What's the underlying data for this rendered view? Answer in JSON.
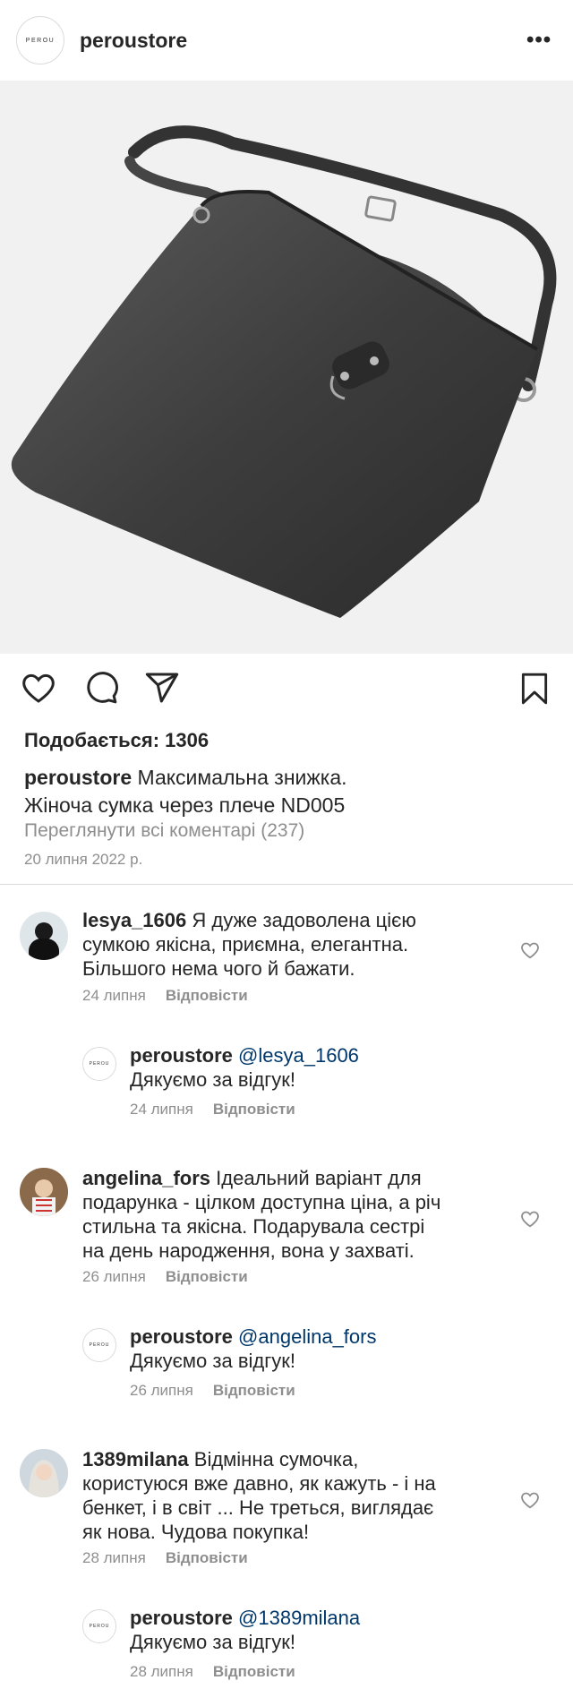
{
  "header": {
    "logo_text": "PEROU",
    "username": "peroustore",
    "more": "•••"
  },
  "post": {
    "likes": "Подобається: 1306",
    "caption_user": "peroustore",
    "caption_line1": "Максимальна знижка.",
    "caption_line2": "Жіноча сумка через плече ND005",
    "view_all": "Переглянути всі коментарі (237)",
    "date": "20 липня 2022 р."
  },
  "comments": [
    {
      "user": "lesya_1606",
      "lines": [
        "Я дуже задоволена цією",
        "сумкою якісна, приємна, елегантна.",
        "Більшого нема чого й бажати."
      ],
      "date": "24 липня",
      "reply": "Відповісти",
      "answer": {
        "user": "peroustore",
        "mention": "@lesya_1606",
        "text": "Дякуємо за відгук!",
        "date": "24 липня",
        "reply": "Відповісти"
      }
    },
    {
      "user": "angelina_fors",
      "lines": [
        "Ідеальний варіант для",
        "подарунка - цілком доступна ціна, а річ",
        "стильна та якісна. Подарувала сестрі",
        "на день народження, вона у захваті."
      ],
      "date": "26 липня",
      "reply": "Відповісти",
      "answer": {
        "user": "peroustore",
        "mention": "@angelina_fors",
        "text": "Дякуємо за відгук!",
        "date": "26 липня",
        "reply": "Відповісти"
      }
    },
    {
      "user": "1389milana",
      "lines": [
        "Відмінна сумочка,",
        "користуюся вже давно, як кажуть - і на",
        "бенкет, і в світ ... Не треться, виглядає",
        "як нова. Чудова покупка!"
      ],
      "date": "28 липня",
      "reply": "Відповісти",
      "answer": {
        "user": "peroustore",
        "mention": "@1389milana",
        "text": "Дякуємо за відгук!",
        "date": "28 липня",
        "reply": "Відповісти"
      }
    }
  ],
  "colors": {
    "text": "#262626",
    "muted": "#8e8e8e",
    "mention": "#00376b",
    "divider": "#dbdbdb"
  }
}
